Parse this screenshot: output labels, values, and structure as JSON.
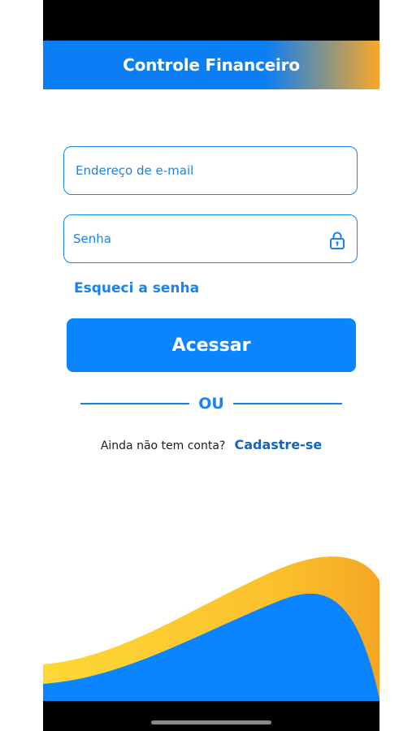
{
  "header": {
    "title": "Controle Financeiro"
  },
  "login_form": {
    "email": {
      "placeholder": "Endereço de e-mail",
      "value": ""
    },
    "password": {
      "placeholder": "Senha",
      "value": "",
      "icon": "lock-icon"
    },
    "forgot_password_label": "Esqueci a senha",
    "submit_label": "Acessar"
  },
  "divider": {
    "label": "OU"
  },
  "signup": {
    "question": "Ainda não tem conta?",
    "link_label": "Cadastre-se"
  },
  "colors": {
    "primary_blue": "#0A84FF",
    "link_blue": "#1A82F0",
    "dark_link_blue": "#1565C0",
    "accent_yellow": "#FBC02D",
    "accent_orange": "#F9A825",
    "system_bar": "#000000"
  }
}
